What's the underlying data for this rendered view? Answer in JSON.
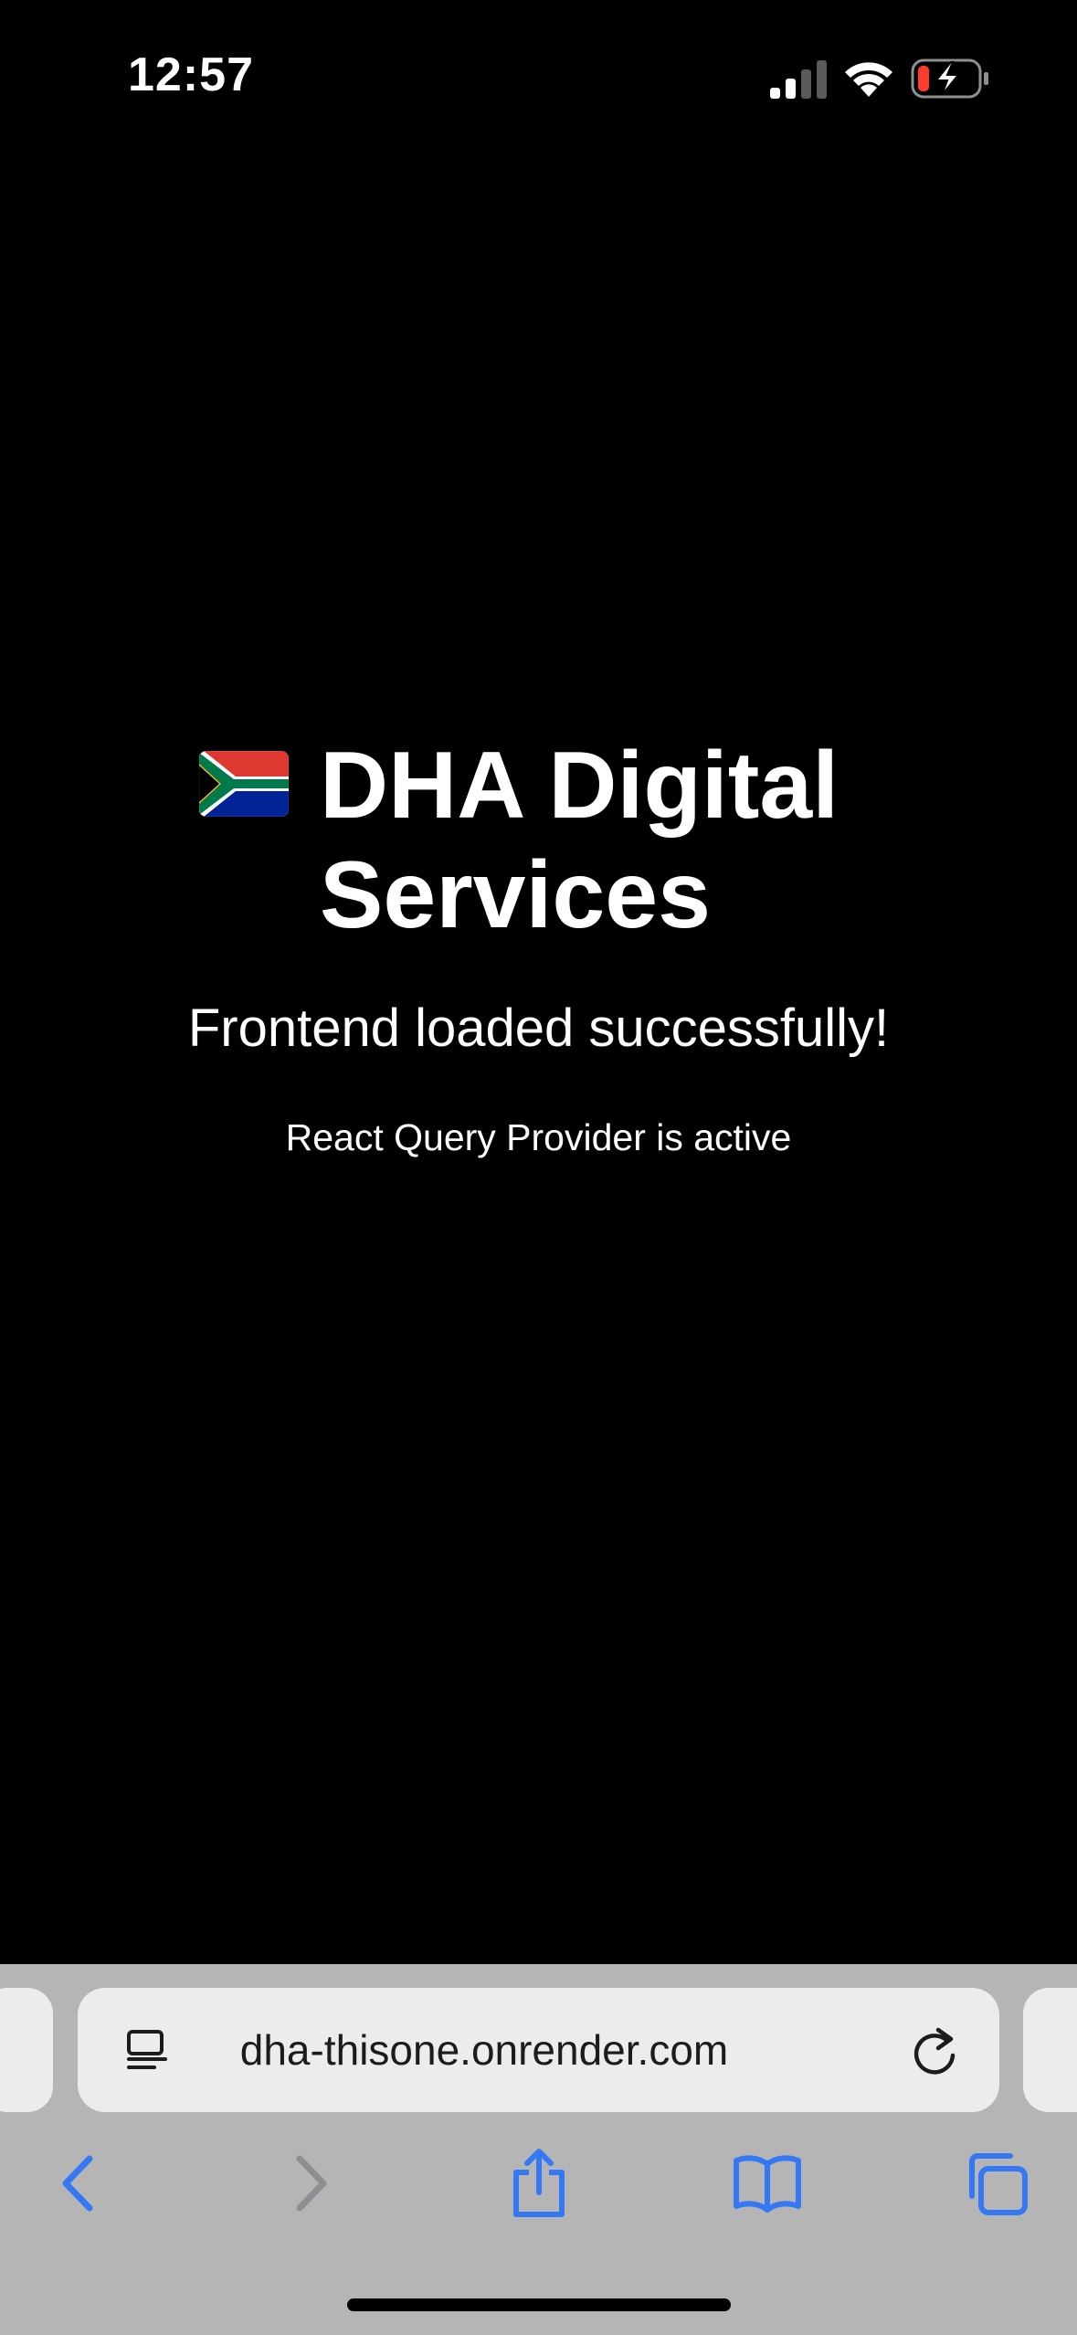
{
  "status_bar": {
    "time": "12:57",
    "signal_icon": "cellular-signal-icon",
    "wifi_icon": "wifi-icon",
    "battery_icon": "battery-charging-icon",
    "battery_level_fraction": 0.15,
    "battery_low_color": "#ff3b30"
  },
  "main": {
    "flag_icon": "south-africa-flag-icon",
    "title": "DHA Digital Services",
    "subtitle": "Frontend loaded successfully!",
    "status": "React Query Provider is active"
  },
  "browser": {
    "address_bar": {
      "url": "dha-thisone.onrender.com",
      "page_menu_icon": "page-menu-icon",
      "reload_icon": "reload-icon"
    },
    "toolbar": {
      "back_icon": "back-chevron-icon",
      "forward_icon": "forward-chevron-icon",
      "share_icon": "share-icon",
      "bookmarks_icon": "bookmarks-icon",
      "tabs_icon": "tabs-icon",
      "active_color": "#3478f6",
      "disabled_color": "#8e8e93"
    }
  },
  "colors": {
    "page_background": "#000000",
    "text": "#ffffff",
    "browser_chrome": "#b5b5b5",
    "address_bar": "#ececec"
  }
}
